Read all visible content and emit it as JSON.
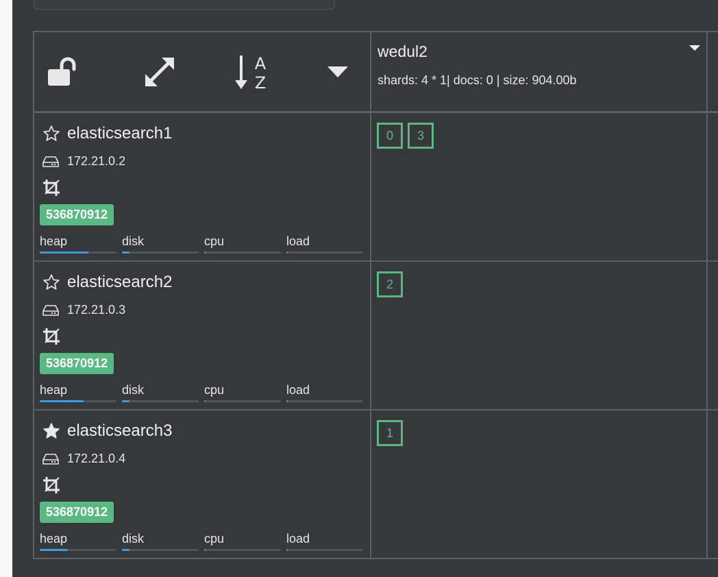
{
  "header": {
    "tools": [
      {
        "icon": "unlock-icon"
      },
      {
        "icon": "expand-icon"
      },
      {
        "icon": "sort-alpha-down-icon"
      },
      {
        "icon": "caret-down-icon"
      }
    ],
    "index": {
      "name": "wedul2",
      "stats": "shards: 4 * 1| docs: 0 | size: 904.00b",
      "menu_icon": "caret-down-icon"
    }
  },
  "nodes": [
    {
      "name": "elasticsearch1",
      "master": false,
      "star_icon": "star-outline-icon",
      "ip": "172.21.0.2",
      "memory": "536870912",
      "metrics": [
        {
          "label": "heap",
          "level": 0.63
        },
        {
          "label": "disk",
          "level": 0.1
        },
        {
          "label": "cpu",
          "level": 0.02
        },
        {
          "label": "load",
          "level": 0.02
        }
      ],
      "shards": [
        "0",
        "3"
      ]
    },
    {
      "name": "elasticsearch2",
      "master": false,
      "star_icon": "star-outline-icon",
      "ip": "172.21.0.3",
      "memory": "536870912",
      "metrics": [
        {
          "label": "heap",
          "level": 0.57
        },
        {
          "label": "disk",
          "level": 0.1
        },
        {
          "label": "cpu",
          "level": 0.02
        },
        {
          "label": "load",
          "level": 0.02
        }
      ],
      "shards": [
        "2"
      ]
    },
    {
      "name": "elasticsearch3",
      "master": true,
      "star_icon": "star-filled-icon",
      "ip": "172.21.0.4",
      "memory": "536870912",
      "metrics": [
        {
          "label": "heap",
          "level": 0.37
        },
        {
          "label": "disk",
          "level": 0.1
        },
        {
          "label": "cpu",
          "level": 0.02
        },
        {
          "label": "load",
          "level": 0.02
        }
      ],
      "shards": [
        "1"
      ]
    }
  ],
  "colors": {
    "background": "#37383b",
    "grid_border": "#5d5f63",
    "shard_green": "#5ab883",
    "badge_green": "#5ab883",
    "bar_blue": "#3d9be0"
  }
}
